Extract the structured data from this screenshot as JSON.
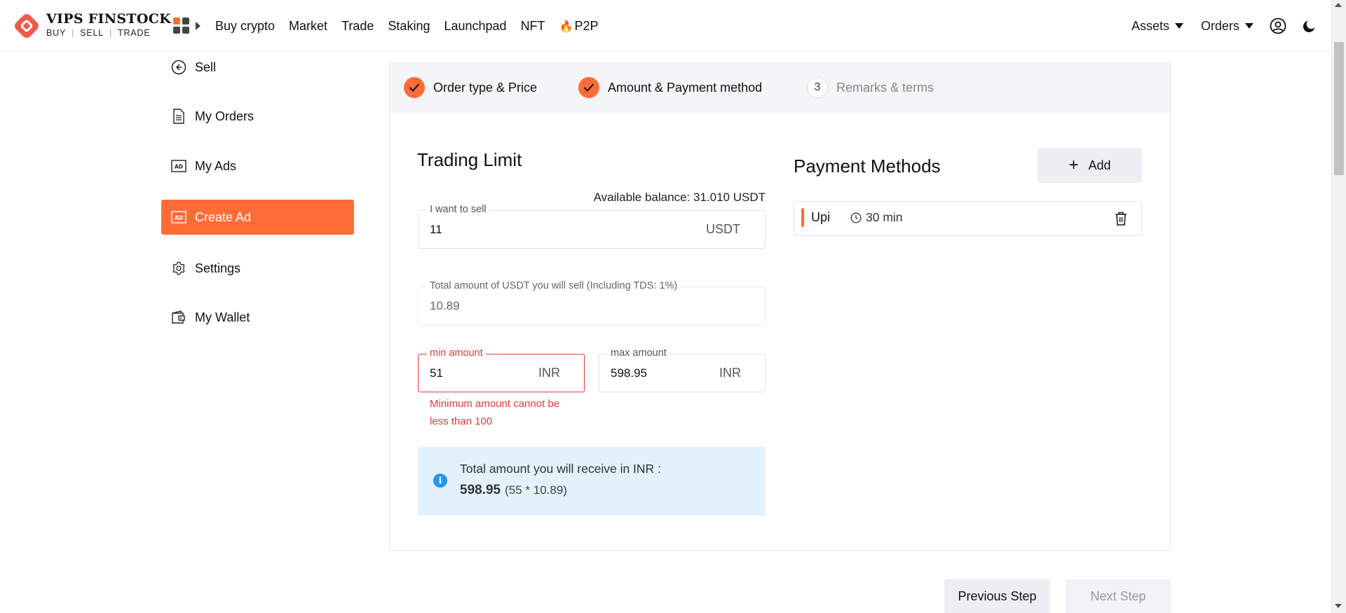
{
  "brand": {
    "name": "VIPS FINSTOCK",
    "tag_buy": "BUY",
    "tag_sell": "SELL",
    "tag_trade": "TRADE",
    "accent": "#ff6c37"
  },
  "nav": {
    "items": [
      "Buy crypto",
      "Market",
      "Trade",
      "Staking",
      "Launchpad",
      "NFT"
    ],
    "p2p": "P2P"
  },
  "header_right": {
    "assets": "Assets",
    "orders": "Orders"
  },
  "sidebar": {
    "items": [
      {
        "label": "Sell",
        "icon": "arrow-left-circle-icon"
      },
      {
        "label": "My Orders",
        "icon": "document-icon"
      },
      {
        "label": "My Ads",
        "icon": "ad-icon"
      },
      {
        "label": "Create Ad",
        "icon": "ad-icon",
        "active": true
      },
      {
        "label": "Settings",
        "icon": "gear-icon"
      },
      {
        "label": "My Wallet",
        "icon": "wallet-icon"
      }
    ]
  },
  "steps": [
    {
      "label": "Order type & Price",
      "done": true
    },
    {
      "label": "Amount & Payment method",
      "done": true
    },
    {
      "number": "3",
      "label": "Remarks & terms",
      "done": false
    }
  ],
  "trading": {
    "title": "Trading Limit",
    "available_label": "Available balance:",
    "available_value": "31.010 USDT",
    "sell_label": "I want to sell",
    "sell_value": "11",
    "sell_unit": "USDT",
    "total_label": "Total amount of USDT you will sell (Including TDS: 1%)",
    "total_value": "10.89",
    "min_label": "min amount",
    "min_value": "51",
    "min_unit": "INR",
    "max_label": "max amount",
    "max_value": "598.95",
    "max_unit": "INR",
    "error": "Minimum amount cannot be less than 100",
    "receive_label": "Total amount you will receive in INR :",
    "receive_value": "598.95",
    "receive_calc": "(55 * 10.89)"
  },
  "payment": {
    "title": "Payment Methods",
    "add_label": "Add",
    "methods": [
      {
        "name": "Upi",
        "time": "30 min"
      }
    ]
  },
  "buttons": {
    "prev": "Previous Step",
    "next": "Next Step"
  }
}
